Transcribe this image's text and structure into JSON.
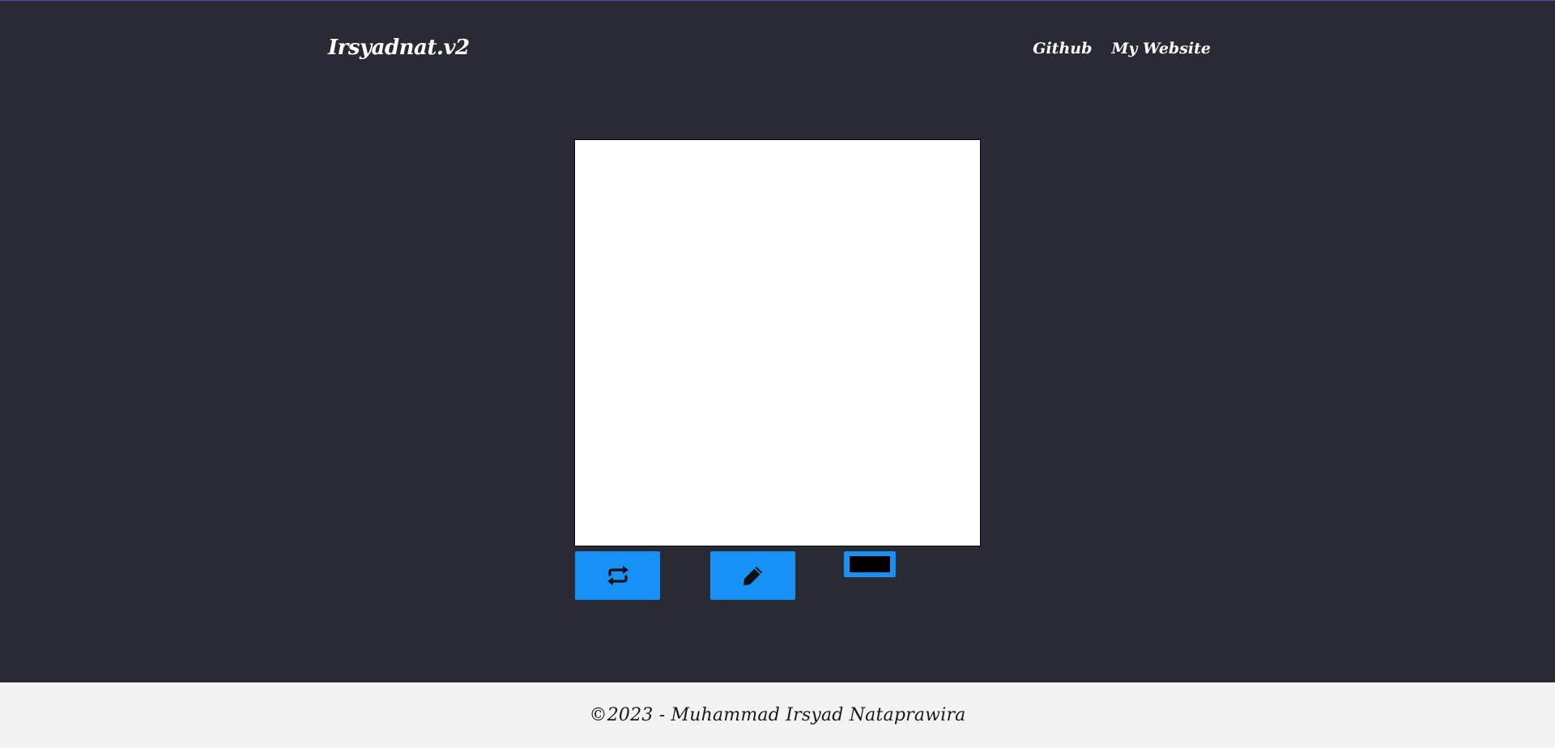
{
  "header": {
    "brand": "Irsyadnat.v2",
    "nav": [
      {
        "label": "Github"
      },
      {
        "label": "My Website"
      }
    ]
  },
  "toolbar": {
    "reset_icon": "repeat-icon",
    "pen_icon": "pencil-icon",
    "selected_color": "#000000"
  },
  "footer": {
    "text": "©2023 - Muhammad Irsyad Nataprawira"
  },
  "colors": {
    "background": "#292a33",
    "accent": "#1791f5",
    "footer_bg": "#f3f3f3"
  }
}
